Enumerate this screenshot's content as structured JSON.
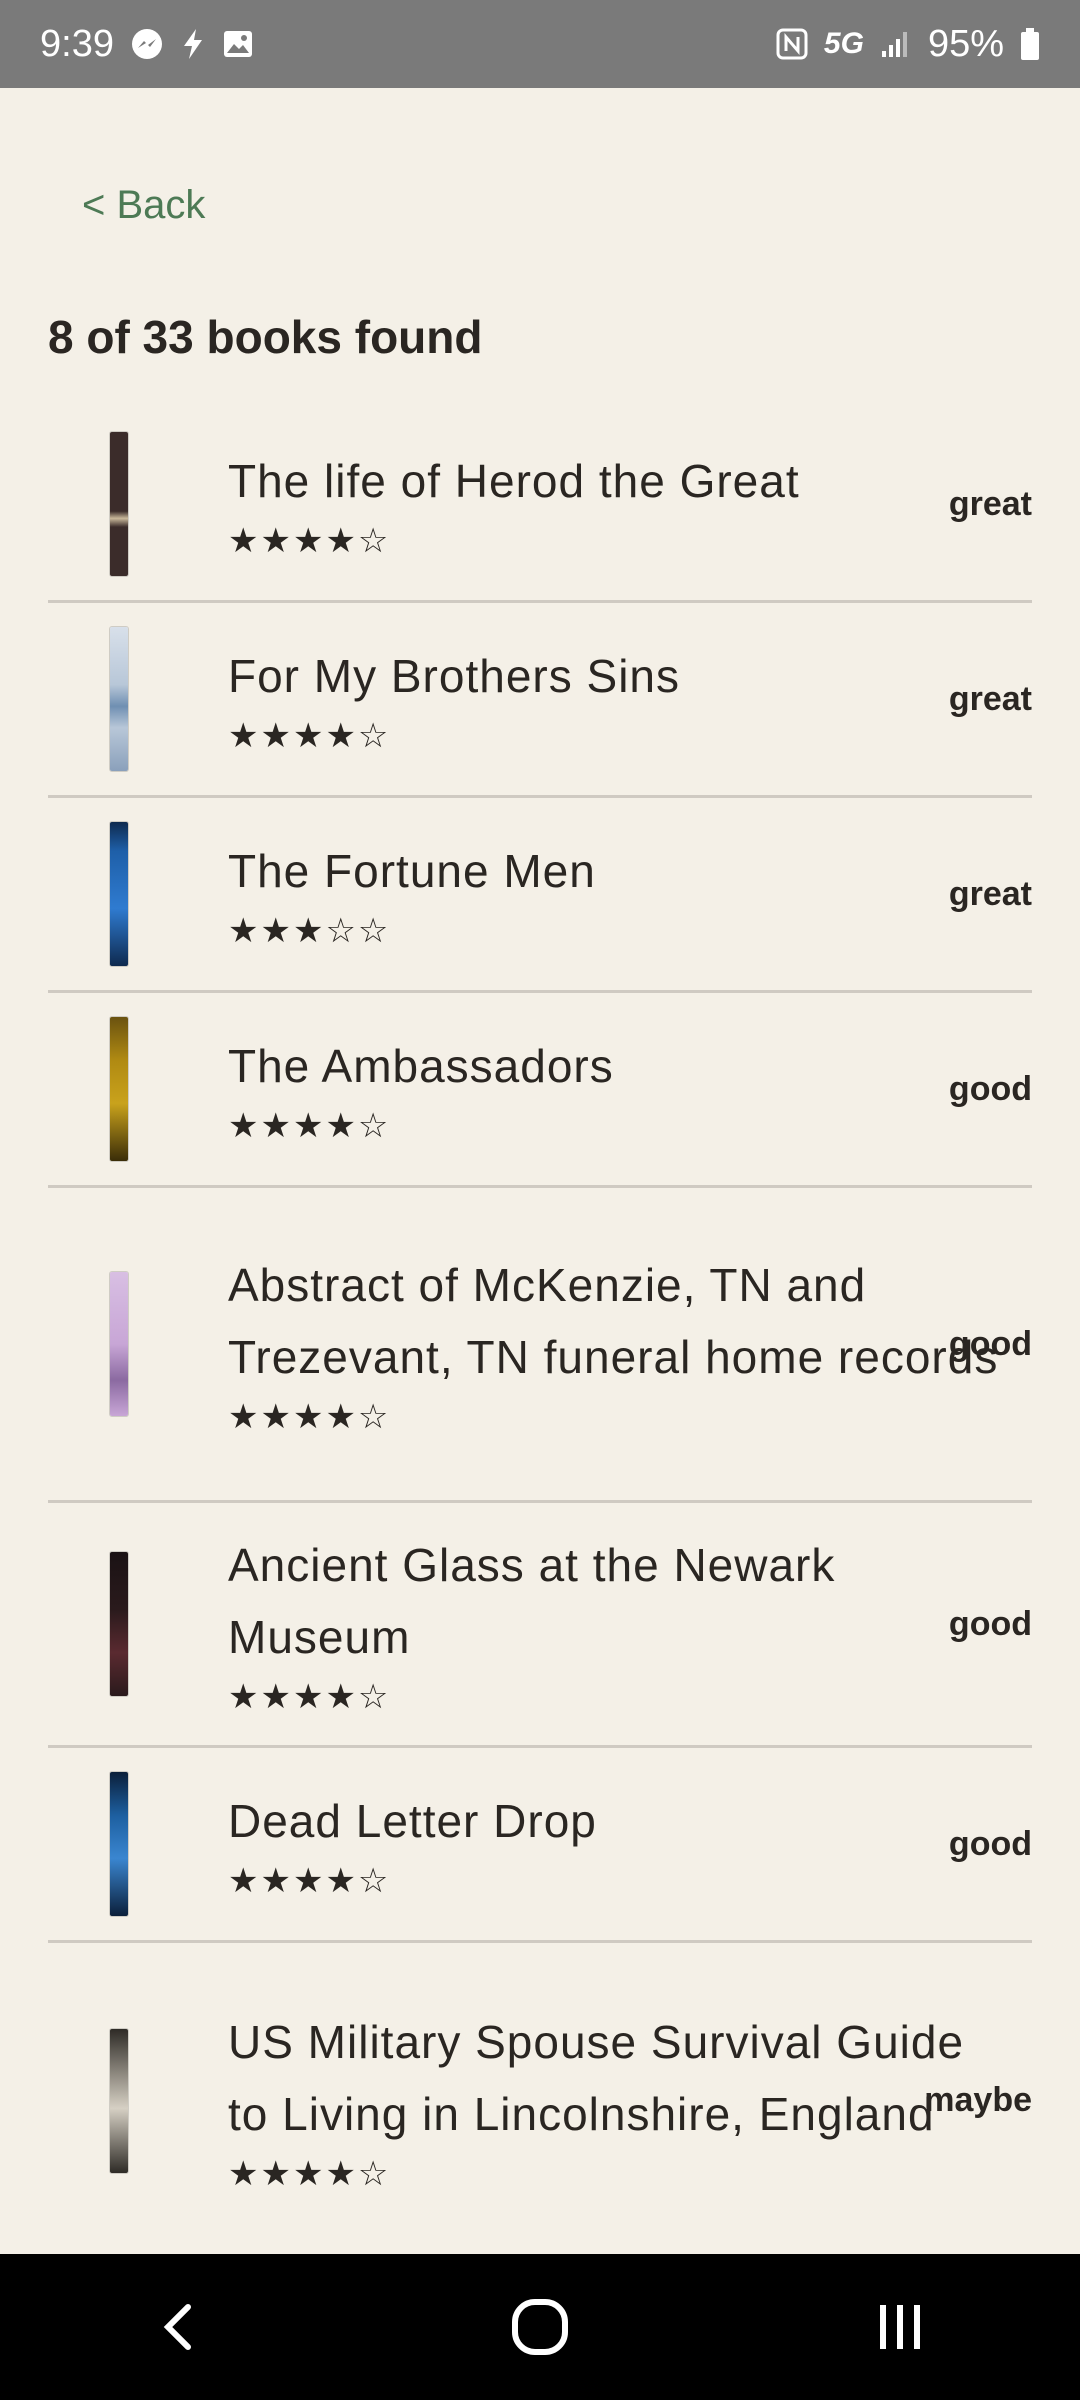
{
  "status_bar": {
    "time": "9:39",
    "network": "5G",
    "battery": "95%",
    "icons": [
      "messenger-icon",
      "bolt-icon",
      "gallery-icon",
      "nfc-icon",
      "signal-icon",
      "battery-icon"
    ]
  },
  "header": {
    "back_label": "< Back",
    "results_text": "8 of 33 books found"
  },
  "books": [
    {
      "title": "The life of Herod the Great",
      "rating": "★★★★☆",
      "stars": 4,
      "status": "great",
      "spine_color": "#3b2c2a",
      "spine_accent": "#c9b89a"
    },
    {
      "title": "For My Brothers Sins",
      "rating": "★★★★☆",
      "stars": 4,
      "status": "great",
      "spine_color": "#b8c7d8",
      "spine_accent": "#6f8fb2"
    },
    {
      "title": "The Fortune Men",
      "rating": "★★★☆☆",
      "stars": 3,
      "status": "great",
      "spine_color": "#1e5fa8",
      "spine_accent": "#0e2a4f"
    },
    {
      "title": "The Ambassadors",
      "rating": "★★★★☆",
      "stars": 4,
      "status": "good",
      "spine_color": "#b08a12",
      "spine_accent": "#3a2d08"
    },
    {
      "title": "Abstract of McKenzie, TN and Trezevant, TN funeral home records",
      "rating": "★★★★☆",
      "stars": 4,
      "status": "good",
      "spine_color": "#c8a6d6",
      "spine_accent": "#8b6aa1"
    },
    {
      "title": "Ancient Glass at the Newark Museum",
      "rating": "★★★★☆",
      "stars": 4,
      "status": "good",
      "spine_color": "#2a1a1c",
      "spine_accent": "#5a2a30"
    },
    {
      "title": "Dead Letter Drop",
      "rating": "★★★★☆",
      "stars": 4,
      "status": "good",
      "spine_color": "#1d5fa0",
      "spine_accent": "#0b1f3a"
    },
    {
      "title": "US Military Spouse Survival Guide to Living in Lincolnshire, England",
      "rating": "★★★★☆",
      "stars": 4,
      "status": "maybe",
      "spine_color": "#8a857c",
      "spine_accent": "#2e2b26"
    }
  ],
  "colors": {
    "background": "#f4f0e7",
    "link": "#4d7a55",
    "divider": "#cfcac2",
    "status_bar": "#7a7a7a",
    "nav_bar": "#000000"
  }
}
